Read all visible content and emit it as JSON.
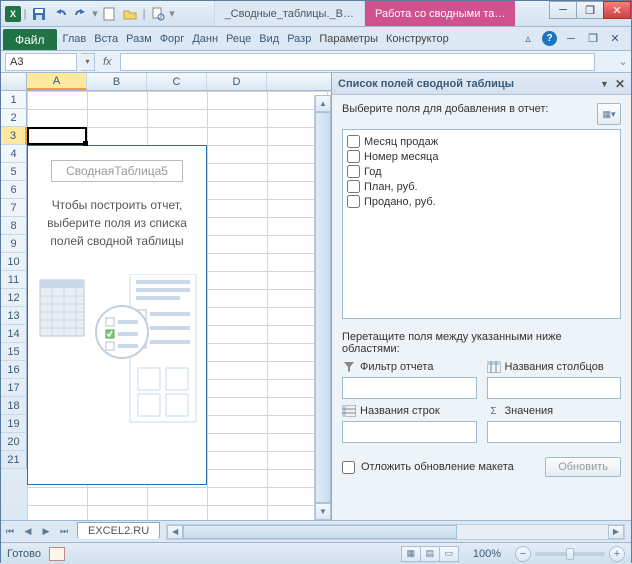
{
  "titlebar": {
    "doc_title": "_Сводные_таблицы._В…",
    "context_title": "Работа со сводными та…"
  },
  "win": {
    "min": "─",
    "max": "❐",
    "close": "✕"
  },
  "ribbon": {
    "file": "Файл",
    "tabs": [
      "Глав",
      "Вста",
      "Разм",
      "Форг",
      "Данн",
      "Реце",
      "Вид",
      "Разр"
    ],
    "ctx_tabs": [
      "Параметры",
      "Конструктор"
    ]
  },
  "namebox": {
    "value": "A3",
    "fx": "fx"
  },
  "columns": [
    "A",
    "B",
    "C",
    "D"
  ],
  "rows": [
    "1",
    "2",
    "3",
    "4",
    "5",
    "6",
    "7",
    "8",
    "9",
    "10",
    "11",
    "12",
    "13",
    "14",
    "15",
    "16",
    "17",
    "18",
    "19",
    "20",
    "21"
  ],
  "pivot": {
    "name": "СводнаяТаблица5",
    "hint": "Чтобы построить отчет, выберите поля из списка полей сводной таблицы"
  },
  "pane": {
    "title": "Список полей сводной таблицы",
    "instruction": "Выберите поля для добавления в отчет:",
    "fields": [
      "Месяц продаж",
      "Номер месяца",
      "Год",
      "План, руб.",
      "Продано, руб."
    ],
    "drag_label": "Перетащите поля между указанными ниже областями:",
    "areas": {
      "filter": "Фильтр отчета",
      "columns": "Названия столбцов",
      "rows": "Названия строк",
      "values": "Значения"
    },
    "defer": "Отложить обновление макета",
    "update": "Обновить"
  },
  "sheet": {
    "tab": "EXCEL2.RU"
  },
  "status": {
    "ready": "Готово",
    "zoom": "100%"
  }
}
